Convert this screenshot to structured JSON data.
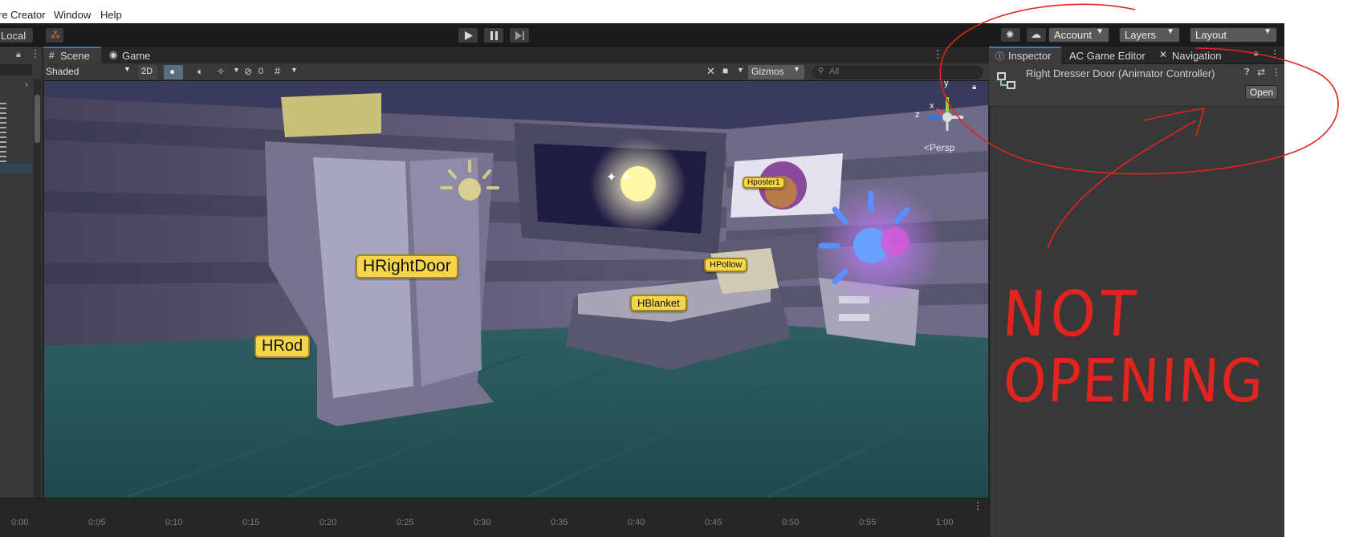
{
  "menubar": {
    "items": [
      "re Creator",
      "Window",
      "Help"
    ]
  },
  "toolbar": {
    "local_label": "Local",
    "play_icon": "play-icon",
    "pause_icon": "pause-icon",
    "step_icon": "step-icon",
    "account_label": "Account",
    "layers_label": "Layers",
    "layout_label": "Layout"
  },
  "scene_tabs": [
    {
      "label": "Scene",
      "active": true
    },
    {
      "label": "Game",
      "active": false
    }
  ],
  "scene_toolbar": {
    "shading_mode": "Shaded",
    "mode_2d": "2D",
    "hidden_count": "0",
    "gizmos_label": "Gizmos",
    "search_placeholder": "All"
  },
  "scene": {
    "hotspots": [
      "HRightDoor",
      "HRod",
      "HBlanket",
      "HPollow",
      "Hposter1"
    ],
    "gizmo": {
      "y": "y",
      "x": "x",
      "z": "z",
      "projection": "Persp"
    }
  },
  "timeline": {
    "ticks": [
      "0:00",
      "0:05",
      "0:10",
      "0:15",
      "0:20",
      "0:25",
      "0:30",
      "0:35",
      "0:40",
      "0:45",
      "0:50",
      "0:55",
      "1:00"
    ]
  },
  "inspector": {
    "tabs": [
      "Inspector",
      "AC Game Editor",
      "Navigation"
    ],
    "object_title": "Right Dresser Door (Animator Controller)",
    "open_button": "Open"
  },
  "annotation": {
    "line1": "NOT",
    "line2": "OPENING",
    "color": "#e2241f"
  },
  "colors": {
    "accent": "#3a79bb",
    "label_fill": "#f4d64d",
    "editor_dark": "#282828",
    "editor_panel": "#383838"
  }
}
